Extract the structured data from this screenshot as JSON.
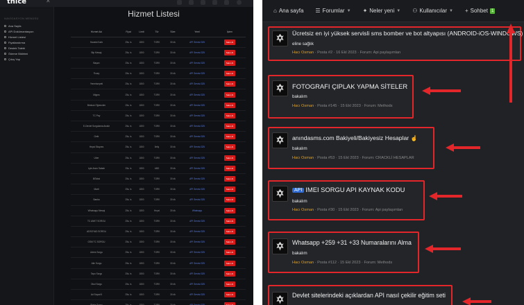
{
  "left_panel": {
    "logo": "tnice",
    "sidebar": {
      "section": "NAVİGASYON MENÜSÜ",
      "items": [
        "Ana Sayfa",
        "API Dokümantasyon",
        "Hizmet Listesi",
        "Fiyatlandırma",
        "Destek Talebi",
        "Ödeme Bildirimi",
        "Çıkış Yap"
      ]
    },
    "page_title": "Hizmet Listesi",
    "table": {
      "headers": [
        "Hizmet Adı",
        "Fiyat",
        "Limit",
        "Tür",
        "Süre",
        "Yerel",
        "İşlem"
      ],
      "rows": [
        [
          "Havaist Kartı",
          "25₺ /s",
          "1800",
          "TÜRK",
          "30 dk",
          "API Servisi 325",
          "Satın Al"
        ],
        [
          "Bip Mesajı",
          "25₺ /s",
          "1800",
          "TÜRK",
          "30 dk",
          "API Servisi 325",
          "Satın Al"
        ],
        [
          "Başarı",
          "25₺ /s",
          "1800",
          "TÜRK",
          "30 dk",
          "API Servisi 325",
          "Satın Al"
        ],
        [
          "Ticary",
          "25₺ /s",
          "1800",
          "TÜRK",
          "30 dk",
          "API Servisi 325",
          "Satın Al"
        ],
        [
          "Yemeksepeti",
          "25₺ /s",
          "1800",
          "TÜRK",
          "30 dk",
          "API Servisi 325",
          "Satın Al"
        ],
        [
          "Migros",
          "25₺ /s",
          "1800",
          "TÜRK",
          "30 dk",
          "API Servisi 325",
          "Satın Al"
        ],
        [
          "Bimbuk Öğrenciler",
          "25₺ /s",
          "1800",
          "TÜRK",
          "30 dk",
          "API Servisi 325",
          "Satın Al"
        ],
        [
          "TC Pay",
          "25₺ /s",
          "1800",
          "TÜRK",
          "30 dk",
          "API Servisi 325",
          "Satın Al"
        ],
        [
          "E-Devlet Sorgulama Analiz",
          "25₺ /s",
          "1800",
          "TÜRK",
          "30 dk",
          "API Servisi 325",
          "Satın Al"
        ],
        [
          "Getir",
          "25₺ /s",
          "1800",
          "TÜRK",
          "30 dk",
          "API Servisi 325",
          "Satın Al"
        ],
        [
          "Hepsi Ekspres",
          "25₺ /s",
          "1800",
          "İletiş",
          "30 dk",
          "API Servisi 325",
          "Satın Al"
        ],
        [
          "Uber",
          "25₺ /s",
          "1800",
          "TÜRK",
          "30 dk",
          "API Servisi 325",
          "Satın Al"
        ],
        [
          "Lyte Anne Sabah",
          "25₺ /s",
          "1800",
          "ABD",
          "30 dk",
          "API Servisi 325",
          "Satın Al"
        ],
        [
          "BiTaksi",
          "25₺ /s",
          "1800",
          "TÜRK",
          "30 dk",
          "API Servisi 325",
          "Satın Al"
        ],
        [
          "Marti",
          "25₺ /s",
          "1800",
          "TÜRK",
          "30 dk",
          "API Servisi 325",
          "Satın Al"
        ],
        [
          "Banka",
          "25₺ /s",
          "1800",
          "TÜRK",
          "30 dk",
          "API Servisi 325",
          "Satın Al"
        ],
        [
          "Whatsapp Mesajı",
          "25₺ /s",
          "1800",
          "Hepsi",
          "30 dk",
          "Whatsapp",
          "Satın Al"
        ],
        [
          "TC ANKT SORGU",
          "25₺ /s",
          "1800",
          "TÜRK",
          "30 dk",
          "API Servisi 325",
          "Satın Al"
        ],
        [
          "ADSOYAD SORGU",
          "25₺ /s",
          "1800",
          "TÜRK",
          "30 dk",
          "API Servisi 325",
          "Satın Al"
        ],
        [
          "GSM TC SORGU",
          "25₺ /s",
          "1800",
          "TÜRK",
          "30 dk",
          "API Servisi 325",
          "Satın Al"
        ],
        [
          "Adres Sorgu",
          "25₺ /s",
          "1800",
          "TÜRK",
          "30 dk",
          "API Servisi 325",
          "Satın Al"
        ],
        [
          "Aile Sorgu",
          "25₺ /s",
          "1800",
          "TÜRK",
          "30 dk",
          "API Servisi 325",
          "Satın Al"
        ],
        [
          "Tapu Sorgu",
          "25₺ /s",
          "1800",
          "TÜRK",
          "30 dk",
          "API Servisi 325",
          "Satın Al"
        ],
        [
          "Okul Sorgu",
          "25₺ /s",
          "1800",
          "TÜRK",
          "30 dk",
          "API Servisi 325",
          "Satın Al"
        ],
        [
          "Ad Soyad İl",
          "25₺ /s",
          "1800",
          "TÜRK",
          "30 dk",
          "API Servisi 325",
          "Satın Al"
        ],
        [
          "Plaka Sorgu",
          "25₺ /s",
          "1800",
          "TÜRK",
          "30 dk",
          "API Servisi 325",
          "Satın Al"
        ]
      ]
    }
  },
  "right_panel": {
    "nav": [
      {
        "label": "Ana sayfa",
        "icon": "home-icon"
      },
      {
        "label": "Forumlar",
        "icon": "forums-icon"
      },
      {
        "label": "Neler yeni",
        "icon": "bell-icon"
      },
      {
        "label": "Kullanıcılar",
        "icon": "users-icon"
      },
      {
        "label": "Sohbet",
        "icon": "plus-icon",
        "badge": "1"
      }
    ],
    "posts": [
      {
        "title": "Ücretsiz en iyi yüksek servisli sms bomber ve bot altyapısı (ANDROID-iOS-WINDOWS)",
        "sub": "eline sağlık",
        "author": "Hacı Osman",
        "meta": " · Posta #2 · 16 Ekl 2023 · Forum: Api paylaşımları"
      },
      {
        "title": "FOTOGRAFI ÇIPLAK YAPMA SİTELER",
        "sub": "bakalım",
        "author": "Hacı Osman",
        "meta": " · Posta #145 · 15 Ekl 2023 · Forum: Methods"
      },
      {
        "title": "anındasms.com Bakiyeli/Bakiyesiz Hesaplar",
        "sub": "bakalım",
        "author": "Hacı Osman",
        "meta": " · Posta #53 · 15 Ekl 2023 · Forum: CRACKLİ HESAPLAR"
      },
      {
        "title": "IMEI SORGU API KAYNAK KODU",
        "tag": "API",
        "sub": "bakalım",
        "author": "Hacı Osman",
        "meta": " · Posta #30 · 15 Ekl 2023 · Forum: Api paylaşımları"
      },
      {
        "title": "Whatsapp +259 +31 +33 Numaralarını Alma",
        "sub": "bakalım",
        "author": "Hacı Osman",
        "meta": " · Posta #112 · 15 Ekl 2023 · Forum: Methods"
      },
      {
        "title": "Devlet sitelerindeki açıklardan API nasıl çekilir eğitim seti",
        "sub": "",
        "author": "",
        "meta": ""
      }
    ],
    "colors": {
      "highlight": "#e2262a",
      "author": "#e6a21d",
      "background": "#202226"
    }
  }
}
